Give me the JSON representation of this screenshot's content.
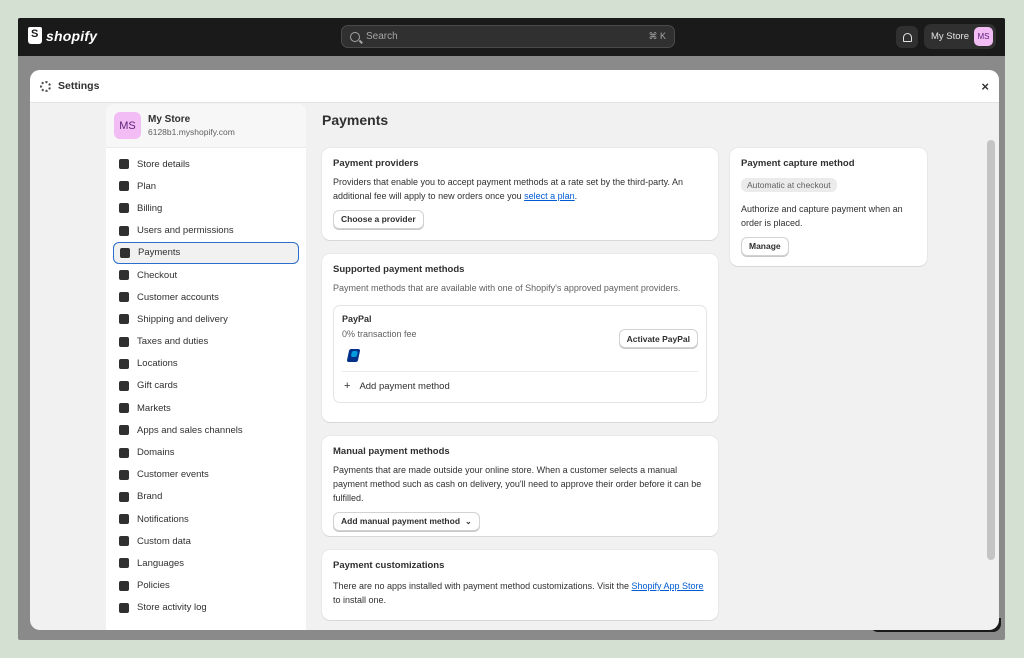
{
  "topbar": {
    "brand": "shopify",
    "search_placeholder": "Search",
    "shortcut": "⌘ K",
    "store_label": "My Store",
    "avatar_initials": "MS"
  },
  "modal": {
    "title": "Settings",
    "close_label": "×"
  },
  "store": {
    "initials": "MS",
    "name": "My Store",
    "domain": "6128b1.myshopify.com"
  },
  "sidebar": {
    "items": [
      {
        "label": "Store details",
        "icon": "store-icon"
      },
      {
        "label": "Plan",
        "icon": "plan-icon"
      },
      {
        "label": "Billing",
        "icon": "billing-icon"
      },
      {
        "label": "Users and permissions",
        "icon": "users-icon"
      },
      {
        "label": "Payments",
        "icon": "payments-icon",
        "active": true
      },
      {
        "label": "Checkout",
        "icon": "cart-icon"
      },
      {
        "label": "Customer accounts",
        "icon": "person-icon"
      },
      {
        "label": "Shipping and delivery",
        "icon": "truck-icon"
      },
      {
        "label": "Taxes and duties",
        "icon": "tax-icon"
      },
      {
        "label": "Locations",
        "icon": "location-icon"
      },
      {
        "label": "Gift cards",
        "icon": "gift-card-icon"
      },
      {
        "label": "Markets",
        "icon": "globe-icon"
      },
      {
        "label": "Apps and sales channels",
        "icon": "apps-icon"
      },
      {
        "label": "Domains",
        "icon": "domain-icon"
      },
      {
        "label": "Customer events",
        "icon": "events-icon"
      },
      {
        "label": "Brand",
        "icon": "brand-icon"
      },
      {
        "label": "Notifications",
        "icon": "bell-icon"
      },
      {
        "label": "Custom data",
        "icon": "data-icon"
      },
      {
        "label": "Languages",
        "icon": "language-icon"
      },
      {
        "label": "Policies",
        "icon": "policy-icon"
      },
      {
        "label": "Store activity log",
        "icon": "list-icon"
      }
    ]
  },
  "main": {
    "title": "Payments",
    "providers": {
      "title": "Payment providers",
      "text_before_link": "Providers that enable you to accept payment methods at a rate set by the third-party. An additional fee will apply to new orders once you ",
      "link": "select a plan",
      "text_after_link": ".",
      "button": "Choose a provider"
    },
    "supported": {
      "title": "Supported payment methods",
      "text": "Payment methods that are available with one of Shopify's approved payment providers.",
      "paypal_name": "PayPal",
      "paypal_fee": "0% transaction fee",
      "activate_button": "Activate PayPal",
      "add_method": "Add payment method"
    },
    "manual": {
      "title": "Manual payment methods",
      "text": "Payments that are made outside your online store. When a customer selects a manual payment method such as cash on delivery, you'll need to approve their order before it can be fulfilled.",
      "button": "Add manual payment method"
    },
    "customizations": {
      "title": "Payment customizations",
      "text_before_link": "There are no apps installed with payment method customizations. Visit the ",
      "link": "Shopify App Store",
      "text_after_link": " to install one."
    },
    "capture": {
      "title": "Payment capture method",
      "badge": "Automatic at checkout",
      "text": "Authorize and capture payment when an order is placed.",
      "button": "Manage"
    }
  }
}
